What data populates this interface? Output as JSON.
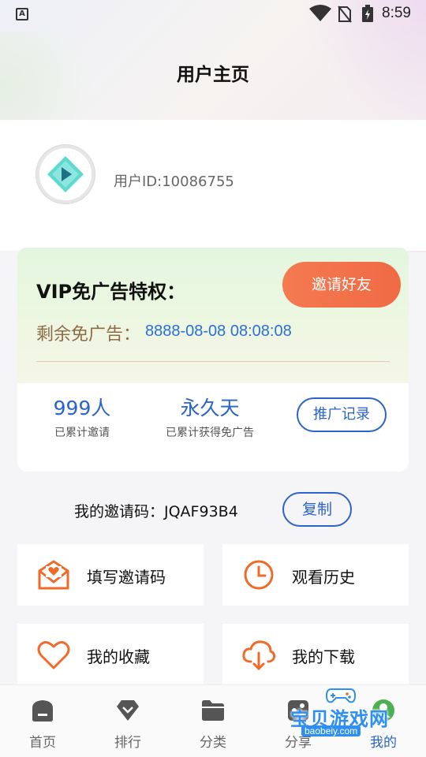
{
  "status_bar": {
    "indicator": "A",
    "time": "8:59"
  },
  "header": {
    "title": "用户主页"
  },
  "profile": {
    "user_id": "用户ID:10086755"
  },
  "vip": {
    "title": "VIP免广告特权：",
    "invite_button": "邀请好友",
    "remaining_label": "剩余免广告：",
    "remaining_value": "8888-08-08 08:08:08",
    "stats": [
      {
        "value": "999人",
        "label": "已累计邀请"
      },
      {
        "value": "永久天",
        "label": "已累计获得免广告"
      }
    ],
    "record_button": "推广记录"
  },
  "invite_code": {
    "label": "我的邀请码：JQAF93B4",
    "copy_button": "复制"
  },
  "tiles": [
    {
      "label": "填写邀请码",
      "icon": "mail-heart-icon"
    },
    {
      "label": "观看历史",
      "icon": "clock-icon"
    },
    {
      "label": "我的收藏",
      "icon": "heart-icon"
    },
    {
      "label": "我的下载",
      "icon": "cloud-download-icon"
    }
  ],
  "tabbar": {
    "items": [
      {
        "label": "首页",
        "icon": "home-icon"
      },
      {
        "label": "排行",
        "icon": "diamond-icon"
      },
      {
        "label": "分类",
        "icon": "folder-icon"
      },
      {
        "label": "分享",
        "icon": "share-icon"
      },
      {
        "label": "我的",
        "icon": "profile-icon"
      }
    ],
    "active_index": 4
  },
  "watermark": {
    "text": "宝贝游戏网",
    "url": "baobeiy.com"
  },
  "colors": {
    "accent": "#2b64c8",
    "invite": "#f06a45",
    "tile_icon": "#f06a2a"
  }
}
